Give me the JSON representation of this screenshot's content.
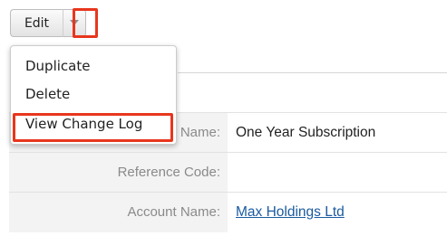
{
  "toolbar": {
    "edit_label": "Edit",
    "dropdown_icon": "caret-down-icon"
  },
  "menu": {
    "items": [
      {
        "label": "Duplicate"
      },
      {
        "label": "Delete"
      },
      {
        "label": "View Change Log"
      }
    ]
  },
  "fields": [
    {
      "label": "Name:",
      "value": "One Year Subscription"
    },
    {
      "label": "Reference Code:",
      "value": ""
    },
    {
      "label": "Account Name:",
      "value": "Max Holdings Ltd"
    }
  ],
  "colors": {
    "highlight": "#e8361d",
    "link": "#1a5aa0",
    "label": "#8a8a8a",
    "label_bg": "#f3f3f3"
  }
}
